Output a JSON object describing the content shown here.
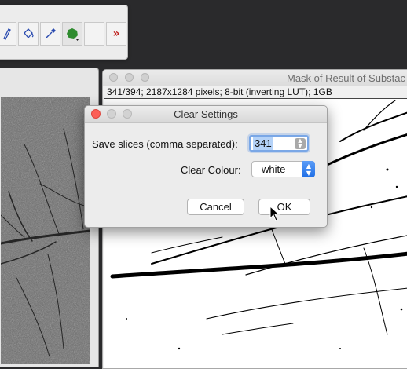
{
  "toolbar": {
    "tools": [
      {
        "icon": "pencil-icon"
      },
      {
        "icon": "flood-fill-icon"
      },
      {
        "icon": "pipette-icon"
      },
      {
        "icon": "green-blob-icon",
        "color": "#2e8b2e"
      },
      {
        "icon": "empty-tool-icon"
      }
    ],
    "more_label": "»"
  },
  "mask_window": {
    "title": "Mask of Result of Substac",
    "info": "341/394; 2187x1284 pixels; 8-bit (inverting LUT); 1GB"
  },
  "dialog": {
    "title": "Clear Settings",
    "slices_label": "Save slices (comma separated):",
    "slices_value": "341",
    "colour_label": "Clear Colour:",
    "colour_value": "white",
    "cancel_label": "Cancel",
    "ok_label": "OK"
  },
  "colors": {
    "close_button": "#fc5f57",
    "select_accent": "#1f6fe6",
    "field_focus": "#7aa7e6"
  }
}
